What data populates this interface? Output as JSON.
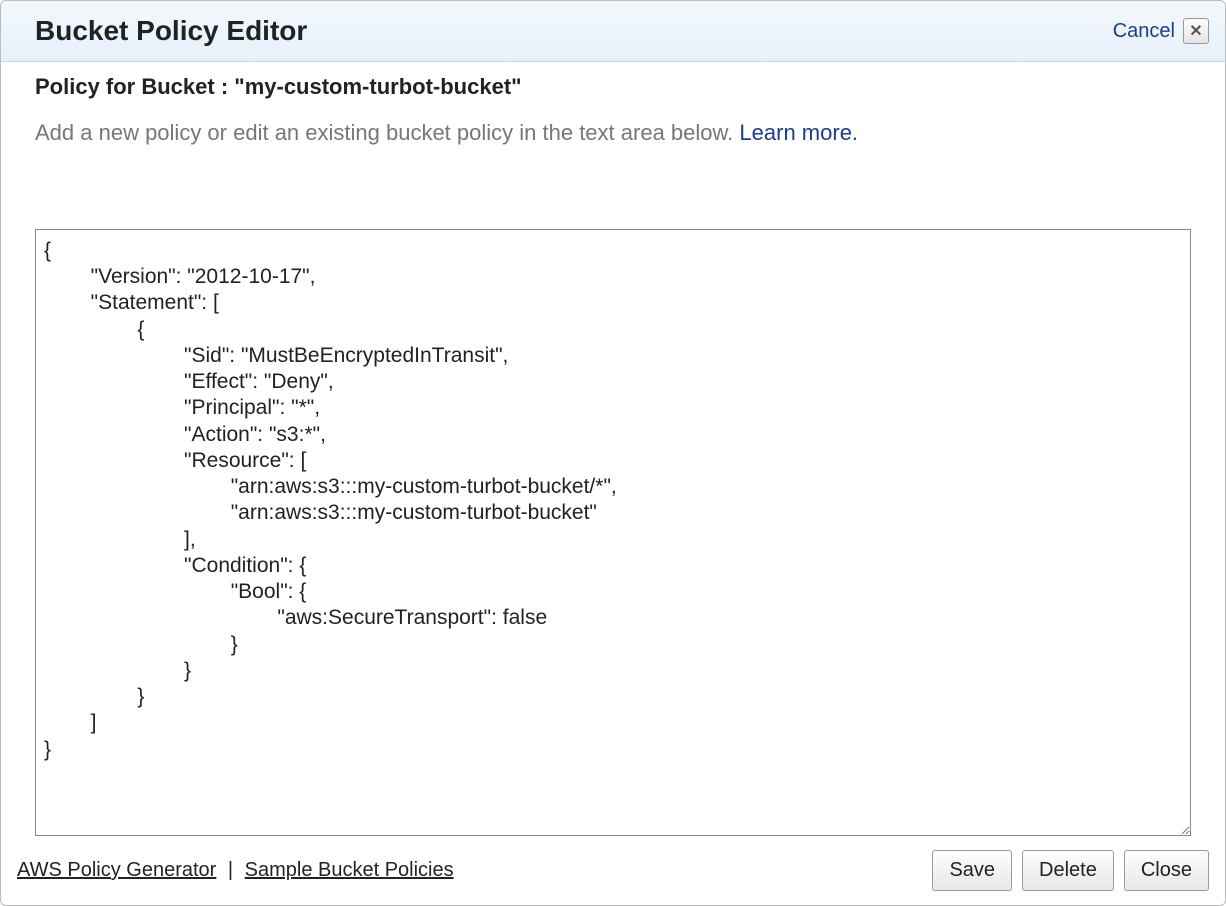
{
  "header": {
    "title": "Bucket Policy Editor",
    "cancel": "Cancel"
  },
  "body": {
    "policy_for": "Policy for Bucket : \"my-custom-turbot-bucket\"",
    "description": "Add a new policy or edit an existing bucket policy in the text area below. ",
    "learn_more": "Learn more.",
    "policy_text": "{\n        \"Version\": \"2012-10-17\",\n        \"Statement\": [\n                {\n                        \"Sid\": \"MustBeEncryptedInTransit\",\n                        \"Effect\": \"Deny\",\n                        \"Principal\": \"*\",\n                        \"Action\": \"s3:*\",\n                        \"Resource\": [\n                                \"arn:aws:s3:::my-custom-turbot-bucket/*\",\n                                \"arn:aws:s3:::my-custom-turbot-bucket\"\n                        ],\n                        \"Condition\": {\n                                \"Bool\": {\n                                        \"aws:SecureTransport\": false\n                                }\n                        }\n                }\n        ]\n}"
  },
  "footer": {
    "link_policy_generator": "AWS Policy Generator",
    "link_sample_policies": "Sample Bucket Policies",
    "separator": " | ",
    "save": "Save",
    "delete": "Delete",
    "close": "Close"
  }
}
